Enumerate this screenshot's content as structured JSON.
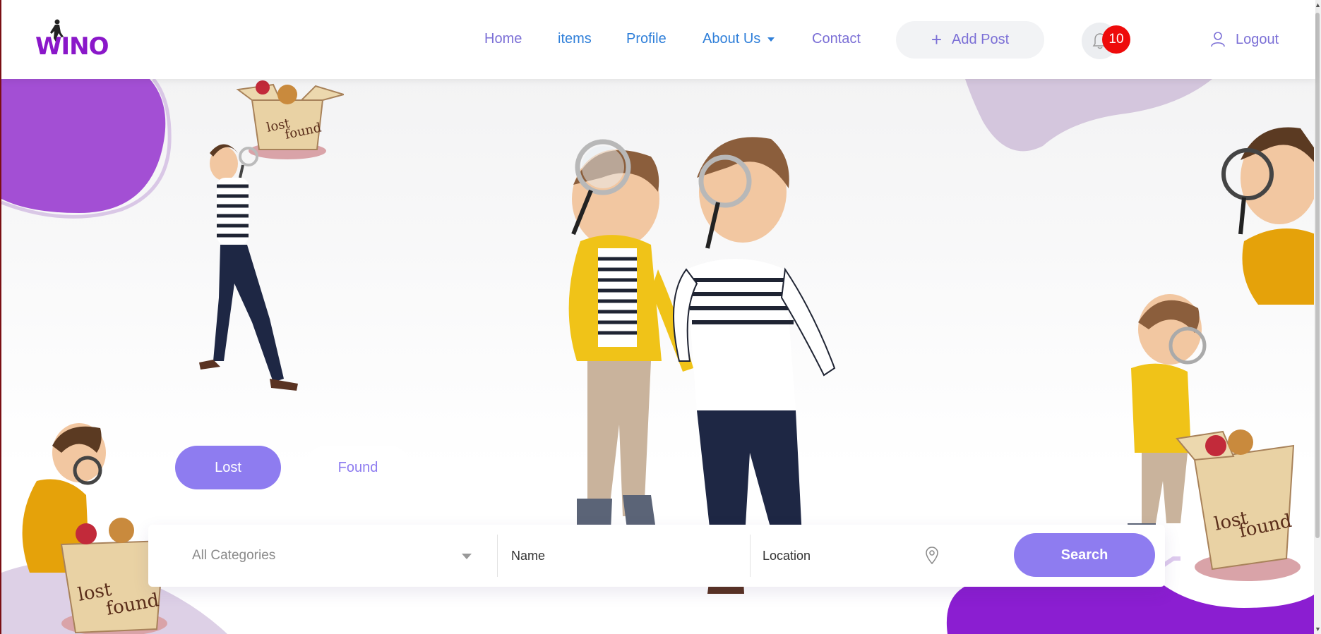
{
  "brand": {
    "logo_text": "WINO",
    "accent": "#8a17c9"
  },
  "nav": {
    "home": "Home",
    "items": "items",
    "profile": "Profile",
    "about": "About Us",
    "contact": "Contact",
    "add_post": "Add Post",
    "notifications_count": "10",
    "logout": "Logout"
  },
  "tabs": {
    "lost": "Lost",
    "found": "Found",
    "active": "Lost"
  },
  "search": {
    "category_selected": "All Categories",
    "name_placeholder": "Name",
    "location_placeholder": "Location",
    "button": "Search"
  },
  "icons": [
    "plus-icon",
    "bell-icon",
    "user-icon",
    "chevron-down-icon",
    "location-pin-icon"
  ],
  "colors": {
    "primary": "#8e7cf0",
    "badge": "#ee0b0b",
    "nav_blue": "#2f7fd9"
  }
}
